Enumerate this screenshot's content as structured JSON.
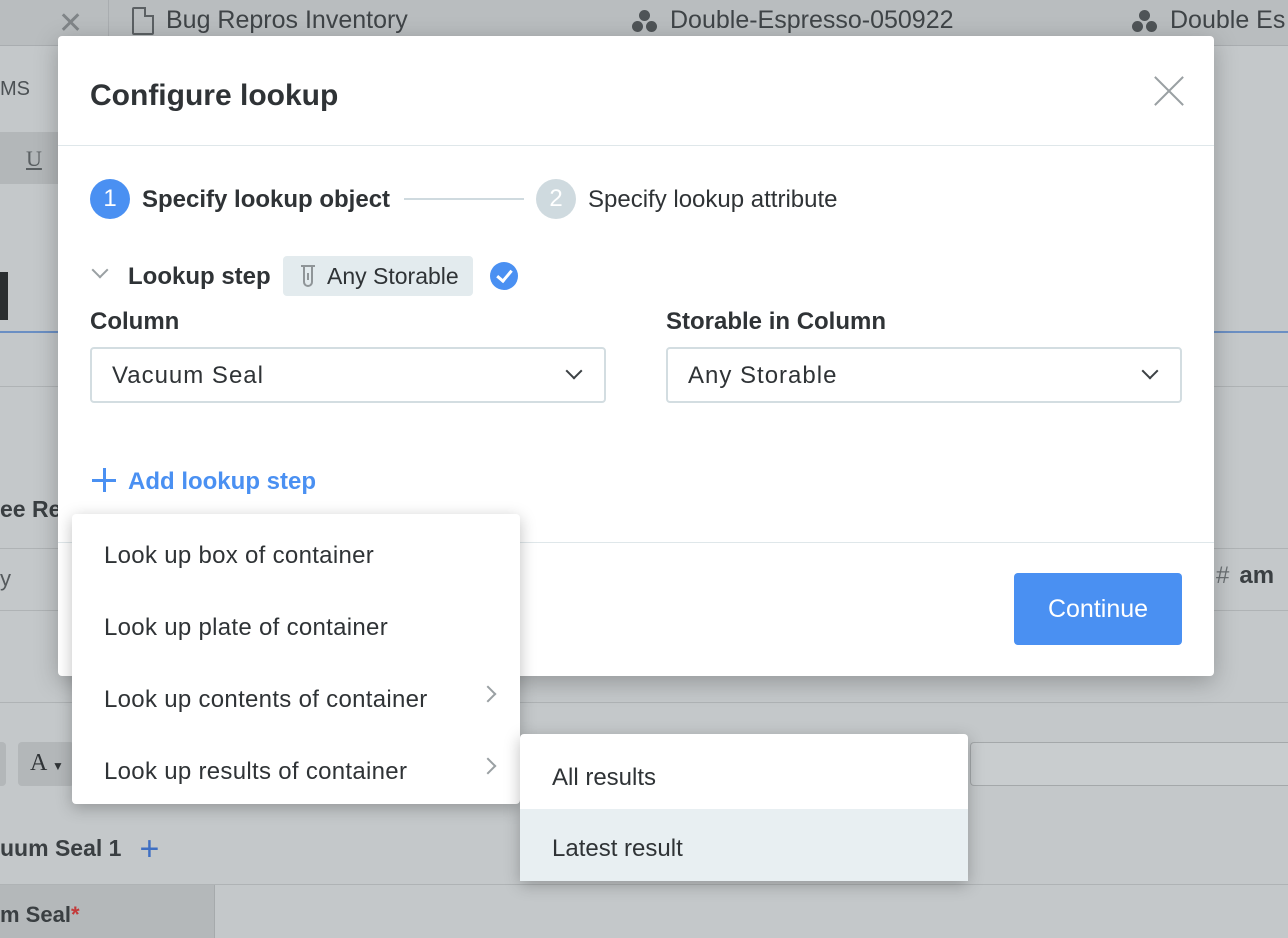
{
  "background": {
    "tabs": [
      {
        "label": "Bug Repros Inventory",
        "icon": "document-icon"
      },
      {
        "label": "Double-Espresso-050922",
        "icon": "molecule-icon"
      },
      {
        "label": "Double Es",
        "icon": "molecule-icon"
      }
    ],
    "nav_fragment": "MS",
    "section_fragment": "ee Re",
    "column_fragment": "am",
    "row_fragment": "y",
    "format_button": "A",
    "underline_button": "U",
    "tab_fragment": "uum Seal 1",
    "field_fragment": "m Seal",
    "required_mark": "*"
  },
  "modal": {
    "title": "Configure lookup",
    "steps": [
      {
        "number": "1",
        "label": "Specify lookup object",
        "state": "active"
      },
      {
        "number": "2",
        "label": "Specify lookup attribute",
        "state": "inactive"
      }
    ],
    "lookup_step": {
      "label": "Lookup step",
      "chip": "Any Storable",
      "icon": "tube-icon",
      "status": "complete"
    },
    "column": {
      "label": "Column",
      "value": "Vacuum Seal"
    },
    "storable": {
      "label": "Storable in Column",
      "value": "Any Storable"
    },
    "add_step_label": "Add lookup step",
    "continue_label": "Continue"
  },
  "menu": {
    "items": [
      {
        "label": "Look up box of container",
        "has_submenu": false
      },
      {
        "label": "Look up plate of container",
        "has_submenu": false
      },
      {
        "label": "Look up contents of container",
        "has_submenu": true
      },
      {
        "label": "Look up results of container",
        "has_submenu": true
      }
    ]
  },
  "submenu": {
    "items": [
      {
        "label": "All results",
        "highlighted": false
      },
      {
        "label": "Latest result",
        "highlighted": true
      }
    ]
  },
  "colors": {
    "accent": "#4a90f2",
    "overlay": "#c4c8ca",
    "text": "#2f3336",
    "highlight": "#e8eff2"
  }
}
